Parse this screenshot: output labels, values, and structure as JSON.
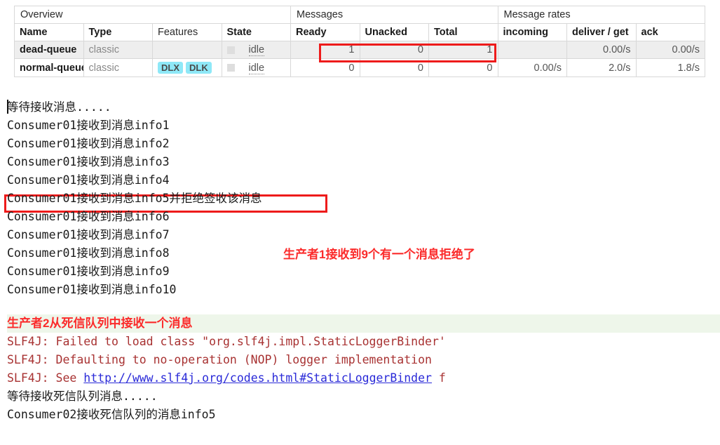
{
  "queues_table": {
    "group_headers": [
      {
        "label": "Overview",
        "span": 4
      },
      {
        "label": "Messages",
        "span": 3
      },
      {
        "label": "Message rates",
        "span": 3
      }
    ],
    "columns": [
      {
        "key": "name",
        "label": "Name",
        "sortable": true
      },
      {
        "key": "type",
        "label": "Type",
        "sortable": true
      },
      {
        "key": "features",
        "label": "Features",
        "sortable": false
      },
      {
        "key": "state",
        "label": "State",
        "sortable": true
      },
      {
        "key": "ready",
        "label": "Ready",
        "sortable": true
      },
      {
        "key": "unacked",
        "label": "Unacked",
        "sortable": true
      },
      {
        "key": "total",
        "label": "Total",
        "sortable": true
      },
      {
        "key": "incoming",
        "label": "incoming",
        "sortable": true
      },
      {
        "key": "deliver_get",
        "label": "deliver / get",
        "sortable": true
      },
      {
        "key": "ack",
        "label": "ack",
        "sortable": true
      }
    ],
    "rows": [
      {
        "name": "dead-queue",
        "type": "classic",
        "features": [],
        "state": "idle",
        "ready": "1",
        "unacked": "0",
        "total": "1",
        "incoming": "",
        "deliver_get": "0.00/s",
        "ack": "0.00/s"
      },
      {
        "name": "normal-queue",
        "type": "classic",
        "features": [
          "DLX",
          "DLK"
        ],
        "state": "idle",
        "ready": "0",
        "unacked": "0",
        "total": "0",
        "incoming": "0.00/s",
        "deliver_get": "2.0/s",
        "ack": "1.8/s"
      }
    ],
    "highlight_color": "#ee1b1b",
    "feature_badge_color": "#8ee8f7"
  },
  "console": {
    "lines": [
      {
        "text": "等待接收消息.....",
        "style": "plain"
      },
      {
        "text": "Consumer01接收到消息info1",
        "style": "plain"
      },
      {
        "text": "Consumer01接收到消息info2",
        "style": "plain"
      },
      {
        "text": "Consumer01接收到消息info3",
        "style": "plain"
      },
      {
        "text": "Consumer01接收到消息info4",
        "style": "plain"
      },
      {
        "text": "Consumer01接收到消息info5并拒绝签收该消息",
        "style": "plain"
      },
      {
        "text": "Consumer01接收到消息info6",
        "style": "plain"
      },
      {
        "text": "Consumer01接收到消息info7",
        "style": "plain"
      },
      {
        "text": "Consumer01接收到消息info8",
        "style": "plain"
      },
      {
        "text": "Consumer01接收到消息info9",
        "style": "plain"
      },
      {
        "text": "Consumer01接收到消息info10",
        "style": "plain"
      },
      {
        "text": "",
        "style": "spacer"
      },
      {
        "text": "生产者2从死信队列中接收一个消息",
        "style": "note-red"
      },
      {
        "text": "SLF4J: Failed to load class \"org.slf4j.impl.StaticLoggerBinder'",
        "style": "err"
      },
      {
        "text": "SLF4J: Defaulting to no-operation (NOP) logger implementation",
        "style": "err"
      },
      {
        "text": "SLF4J: See ",
        "style": "err-link",
        "link_text": "http://www.slf4j.org/codes.html#StaticLoggerBinder",
        "tail": " f"
      },
      {
        "text": "等待接收死信队列消息.....",
        "style": "plain"
      },
      {
        "text": "Consumer02接收死信队列的消息info5",
        "style": "plain"
      }
    ]
  },
  "annotations": {
    "reject_note": "生产者1接收到9个有一个消息拒绝了",
    "accent_color": "#fb2b2b"
  }
}
